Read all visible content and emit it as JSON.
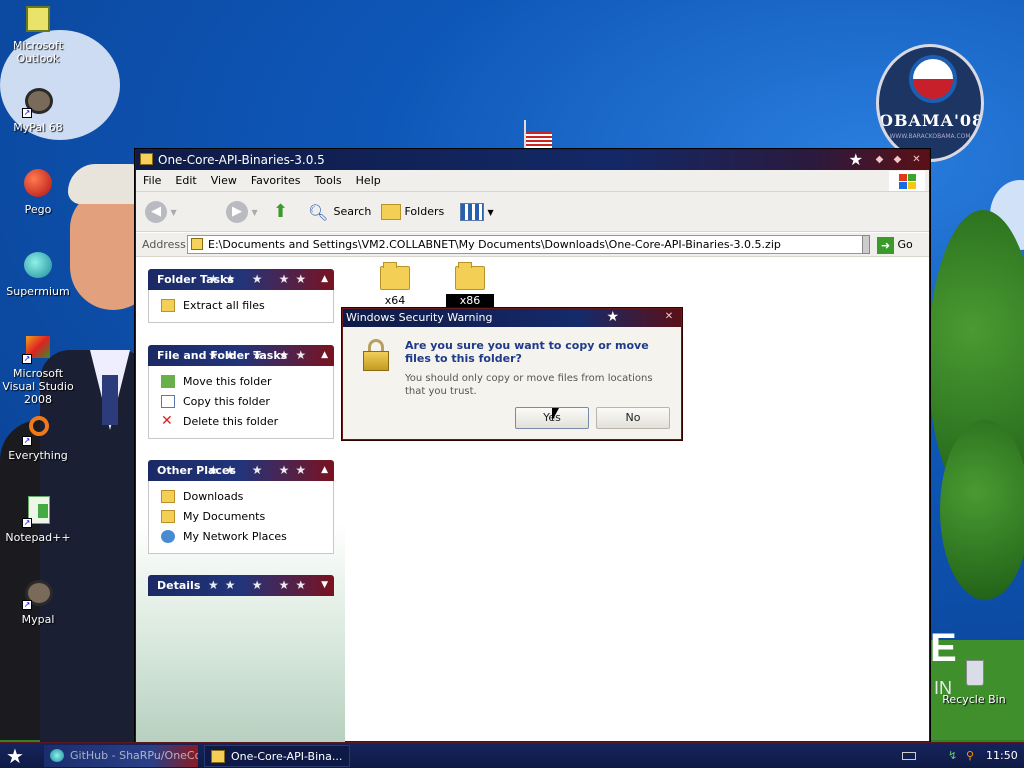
{
  "desktop": {
    "icons": [
      {
        "label": "Microsoft Outlook",
        "icon": "outlook-icon"
      },
      {
        "label": "MyPal 68",
        "icon": "raccoon-icon"
      },
      {
        "label": "Pego",
        "icon": "red-ball-icon"
      },
      {
        "label": "Supermium",
        "icon": "supermium-icon"
      },
      {
        "label": "Microsoft Visual Studio 2008",
        "icon": "visual-studio-icon"
      },
      {
        "label": "Everything",
        "icon": "orange-ring-icon"
      },
      {
        "label": "Notepad++",
        "icon": "notepad-plus-icon"
      },
      {
        "label": "Mypal",
        "icon": "raccoon-icon"
      }
    ],
    "recycle_bin": "Recycle Bin",
    "wallpaper_badge": {
      "title": "OBAMA'08",
      "subtitle": "WWW.BARACKOBAMA.COM"
    },
    "wallpaper_letters": {
      "e": "E",
      "in": "IN"
    }
  },
  "window": {
    "title": "One-Core-API-Binaries-3.0.5",
    "menu": [
      "File",
      "Edit",
      "View",
      "Favorites",
      "Tools",
      "Help"
    ],
    "toolbar": {
      "search": "Search",
      "folders": "Folders"
    },
    "address": {
      "label": "Address",
      "value": "E:\\Documents and Settings\\VM2.COLLABNET\\My Documents\\Downloads\\One-Core-API-Binaries-3.0.5.zip",
      "go": "Go"
    },
    "panels": {
      "folder_tasks": {
        "title": "Folder Tasks",
        "items": [
          "Extract all files"
        ]
      },
      "file_folder_tasks": {
        "title": "File and Folder Tasks",
        "items": [
          "Move this folder",
          "Copy this folder",
          "Delete this folder"
        ]
      },
      "other_places": {
        "title": "Other Places",
        "items": [
          "Downloads",
          "My Documents",
          "My Network Places"
        ]
      },
      "details": {
        "title": "Details"
      }
    },
    "files": [
      {
        "name": "x64"
      },
      {
        "name": "x86"
      }
    ]
  },
  "dialog": {
    "title": "Windows Security Warning",
    "question": "Are you sure you want to copy or move files to this folder?",
    "message": "You should only copy or move files from locations that you trust.",
    "yes": "Yes",
    "no": "No"
  },
  "taskbar": {
    "tasks": [
      {
        "label": "GitHub - ShaRPu/OneCore..."
      },
      {
        "label": "One-Core-API-Bina..."
      }
    ],
    "clock": "11:50 AM"
  },
  "colors": {
    "title_blue": "#132866",
    "title_red": "#5a1017",
    "panel_head": "#1b2a66"
  }
}
